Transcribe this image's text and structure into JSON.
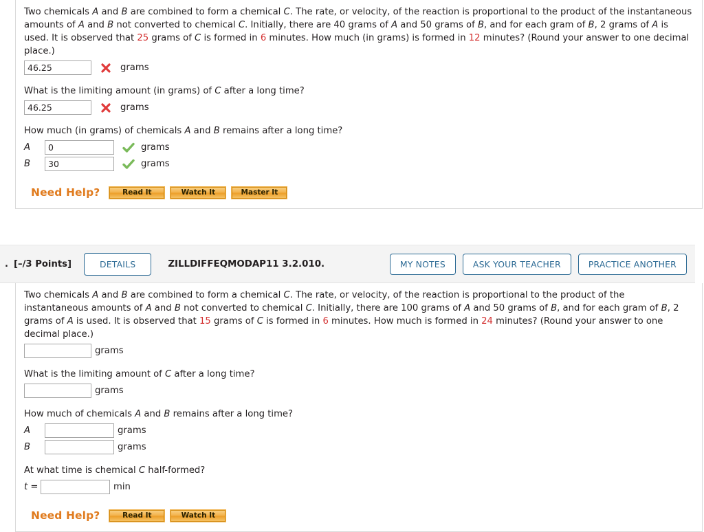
{
  "question_top": {
    "problem_text_parts": [
      {
        "t": "Two chemicals ",
        "k": "p"
      },
      {
        "t": "A",
        "k": "v"
      },
      {
        "t": " and ",
        "k": "p"
      },
      {
        "t": "B",
        "k": "v"
      },
      {
        "t": " are combined to form a chemical ",
        "k": "p"
      },
      {
        "t": "C",
        "k": "v"
      },
      {
        "t": ". The rate, or velocity, of the reaction is proportional to the product of the instantaneous amounts of ",
        "k": "p"
      },
      {
        "t": "A",
        "k": "v"
      },
      {
        "t": " and ",
        "k": "p"
      },
      {
        "t": "B",
        "k": "v"
      },
      {
        "t": " not converted to chemical ",
        "k": "p"
      },
      {
        "t": "C",
        "k": "v"
      },
      {
        "t": ". Initially, there are 40 grams of ",
        "k": "p"
      },
      {
        "t": "A",
        "k": "v"
      },
      {
        "t": " and 50 grams of ",
        "k": "p"
      },
      {
        "t": "B",
        "k": "v"
      },
      {
        "t": ", and for each gram of ",
        "k": "p"
      },
      {
        "t": "B",
        "k": "v"
      },
      {
        "t": ", 2 grams of ",
        "k": "p"
      },
      {
        "t": "A",
        "k": "v"
      },
      {
        "t": " is used. It is observed that ",
        "k": "p"
      },
      {
        "t": "25",
        "k": "n"
      },
      {
        "t": " grams of ",
        "k": "p"
      },
      {
        "t": "C",
        "k": "v"
      },
      {
        "t": " is formed in ",
        "k": "p"
      },
      {
        "t": "6",
        "k": "n"
      },
      {
        "t": " minutes. How much (in grams) is formed in ",
        "k": "p"
      },
      {
        "t": "12",
        "k": "n"
      },
      {
        "t": " minutes? (Round your answer to one decimal place.)",
        "k": "p"
      }
    ],
    "answer1": {
      "value": "46.25",
      "units": "grams",
      "status": "incorrect"
    },
    "prompt2_parts": [
      {
        "t": "What is the limiting amount (in grams) of ",
        "k": "p"
      },
      {
        "t": "C",
        "k": "v"
      },
      {
        "t": " after a long time?",
        "k": "p"
      }
    ],
    "answer2": {
      "value": "46.25",
      "units": "grams",
      "status": "incorrect"
    },
    "prompt3_parts": [
      {
        "t": "How much (in grams) of chemicals ",
        "k": "p"
      },
      {
        "t": "A",
        "k": "v"
      },
      {
        "t": " and ",
        "k": "p"
      },
      {
        "t": "B",
        "k": "v"
      },
      {
        "t": " remains after a long time?",
        "k": "p"
      }
    ],
    "answer_a": {
      "label": "A",
      "value": "0",
      "units": "grams",
      "status": "correct"
    },
    "answer_b": {
      "label": "B",
      "value": "30",
      "units": "grams",
      "status": "correct"
    },
    "need_help": {
      "label": "Need Help?",
      "buttons": [
        "Read It",
        "Watch It",
        "Master It"
      ]
    }
  },
  "question_bottom": {
    "header": {
      "number": ".",
      "points": "[–/3 Points]",
      "details_label": "DETAILS",
      "question_code": "ZILLDIFFEQMODAP11 3.2.010.",
      "my_notes_label": "MY NOTES",
      "ask_teacher_label": "ASK YOUR TEACHER",
      "practice_another_label": "PRACTICE ANOTHER"
    },
    "problem_text_parts": [
      {
        "t": "Two chemicals ",
        "k": "p"
      },
      {
        "t": "A",
        "k": "v"
      },
      {
        "t": " and ",
        "k": "p"
      },
      {
        "t": "B",
        "k": "v"
      },
      {
        "t": " are combined to form a chemical ",
        "k": "p"
      },
      {
        "t": "C",
        "k": "v"
      },
      {
        "t": ". The rate, or velocity, of the reaction is proportional to the product of the instantaneous amounts of ",
        "k": "p"
      },
      {
        "t": "A",
        "k": "v"
      },
      {
        "t": " and ",
        "k": "p"
      },
      {
        "t": "B",
        "k": "v"
      },
      {
        "t": " not converted to chemical ",
        "k": "p"
      },
      {
        "t": "C",
        "k": "v"
      },
      {
        "t": ". Initially, there are 100 grams of ",
        "k": "p"
      },
      {
        "t": "A",
        "k": "v"
      },
      {
        "t": " and 50 grams of ",
        "k": "p"
      },
      {
        "t": "B",
        "k": "v"
      },
      {
        "t": ", and for each gram of ",
        "k": "p"
      },
      {
        "t": "B",
        "k": "v"
      },
      {
        "t": ", 2 grams of ",
        "k": "p"
      },
      {
        "t": "A",
        "k": "v"
      },
      {
        "t": " is used. It is observed that ",
        "k": "p"
      },
      {
        "t": "15",
        "k": "n"
      },
      {
        "t": " grams of ",
        "k": "p"
      },
      {
        "t": "C",
        "k": "v"
      },
      {
        "t": " is formed in ",
        "k": "p"
      },
      {
        "t": "6",
        "k": "n"
      },
      {
        "t": " minutes. How much is formed in ",
        "k": "p"
      },
      {
        "t": "24",
        "k": "n"
      },
      {
        "t": " minutes? (Round your answer to one decimal place.)",
        "k": "p"
      }
    ],
    "answer1": {
      "value": "",
      "units": "grams",
      "status": "none"
    },
    "prompt2_parts": [
      {
        "t": "What is the limiting amount of ",
        "k": "p"
      },
      {
        "t": "C",
        "k": "v"
      },
      {
        "t": " after a long time?",
        "k": "p"
      }
    ],
    "answer2": {
      "value": "",
      "units": "grams",
      "status": "none"
    },
    "prompt3_parts": [
      {
        "t": "How much of chemicals ",
        "k": "p"
      },
      {
        "t": "A",
        "k": "v"
      },
      {
        "t": " and ",
        "k": "p"
      },
      {
        "t": "B",
        "k": "v"
      },
      {
        "t": " remains after a long time?",
        "k": "p"
      }
    ],
    "answer_a": {
      "label": "A",
      "value": "",
      "units": "grams",
      "status": "none"
    },
    "answer_b": {
      "label": "B",
      "value": "",
      "units": "grams",
      "status": "none"
    },
    "prompt4_parts": [
      {
        "t": "At what time is chemical ",
        "k": "p"
      },
      {
        "t": "C",
        "k": "v"
      },
      {
        "t": " half-formed?",
        "k": "p"
      }
    ],
    "answer_t": {
      "label": "t =",
      "value": "",
      "units": "min",
      "status": "none"
    },
    "need_help": {
      "label": "Need Help?",
      "buttons": [
        "Read It",
        "Watch It"
      ]
    }
  },
  "colors": {
    "correct_green": "#7aba5a",
    "incorrect_red": "#e03a3a",
    "highlight_number": "#d32f2f",
    "help_orange": "#e07b1e",
    "button_blue": "#2c6a94"
  }
}
